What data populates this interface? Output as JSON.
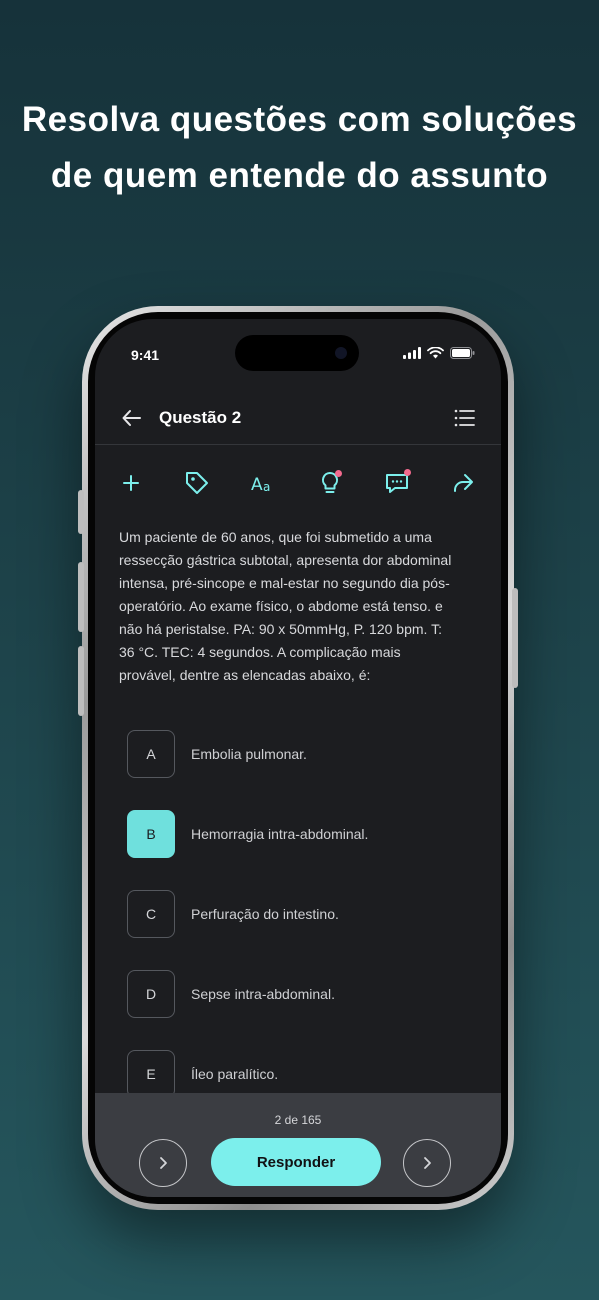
{
  "headline": {
    "line1": "Resolva questões com soluções",
    "line2": "de quem entende do assunto"
  },
  "status": {
    "time": "9:41"
  },
  "header": {
    "title": "Questão 2",
    "back_icon": "arrow-left-icon",
    "menu_icon": "list-icon"
  },
  "toolbar": {
    "items": [
      "plus-icon",
      "tag-icon",
      "font-size-icon",
      "lightbulb-icon",
      "comment-icon",
      "share-icon"
    ]
  },
  "question": {
    "text": "Um paciente de 60 anos, que foi submetido a uma ressecção gástrica subtotal, apresenta dor abdominal intensa, pré-sincope e mal-estar no segundo dia pós-operatório. Ao exame físico, o abdome está tenso. e não há peristalse. PA: 90 x 50mmHg, P. 120 bpm. T: 36 °C. TEC: 4 segundos. A complicação mais provável, dentre as elencadas abaixo, é:"
  },
  "options": [
    {
      "letter": "A",
      "text": "Embolia pulmonar.",
      "selected": false
    },
    {
      "letter": "B",
      "text": "Hemorragia intra-abdominal.",
      "selected": true
    },
    {
      "letter": "C",
      "text": "Perfuração do intestino.",
      "selected": false
    },
    {
      "letter": "D",
      "text": "Sepse intra-abdominal.",
      "selected": false
    },
    {
      "letter": "E",
      "text": "Íleo paralítico.",
      "selected": false
    }
  ],
  "footer": {
    "counter": "2 de 165",
    "answer_label": "Responder"
  },
  "colors": {
    "accent": "#7cefec",
    "selected": "#6fe0dd",
    "notification_dot": "#f36a8e",
    "screen_bg": "#1c1d20"
  }
}
